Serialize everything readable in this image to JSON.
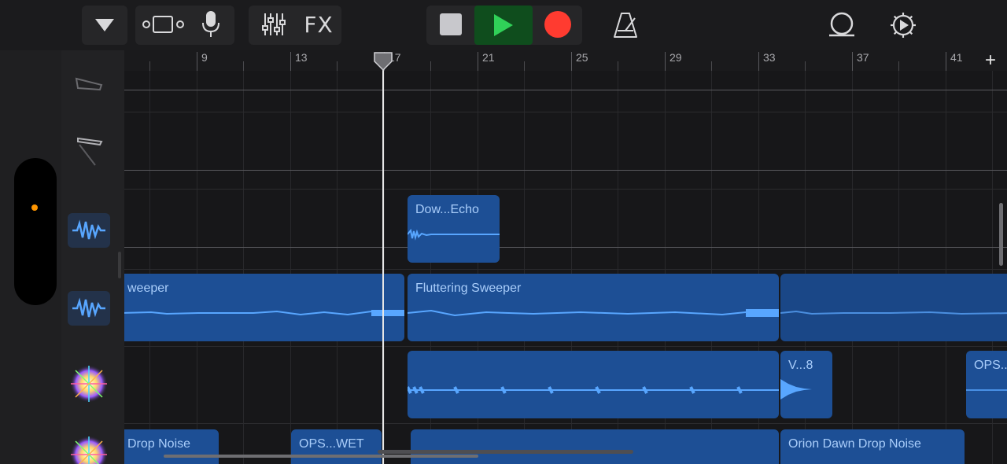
{
  "toolbar": {
    "buttons": [
      {
        "id": "menu",
        "icon": "triangle-down-icon"
      },
      {
        "id": "tracks-view",
        "icon": "tracks-view-icon"
      },
      {
        "id": "mic",
        "icon": "microphone-icon"
      },
      {
        "id": "mixer",
        "icon": "sliders-icon"
      },
      {
        "id": "fx",
        "label": "FX"
      },
      {
        "id": "stop",
        "icon": "stop-icon"
      },
      {
        "id": "play",
        "icon": "play-icon"
      },
      {
        "id": "record",
        "icon": "record-icon"
      },
      {
        "id": "metronome",
        "icon": "metronome-icon"
      },
      {
        "id": "loop",
        "icon": "loop-icon"
      },
      {
        "id": "settings",
        "icon": "gear-icon"
      }
    ],
    "fx_label": "FX",
    "colors": {
      "play_bg": "#0f4d1d",
      "play_icon": "#30d158",
      "record": "#ff3b30"
    }
  },
  "ruler": {
    "bars": [
      "9",
      "13",
      "17",
      "21",
      "25",
      "29",
      "33",
      "37",
      "41"
    ],
    "add_label": "+"
  },
  "tracks": [
    {
      "icon": "synth-icon"
    },
    {
      "icon": "keyboard-icon"
    },
    {
      "icon": "audio-wave-icon"
    },
    {
      "icon": "audio-wave-icon"
    },
    {
      "icon": "sparkle-icon"
    },
    {
      "icon": "sparkle-icon"
    }
  ],
  "regions": {
    "r1": "Dow...Echo",
    "r2a": "weeper",
    "r2b": "Fluttering Sweeper",
    "r3b": "V...8",
    "r3c": "OPS...",
    "r4a": "Drop Noise",
    "r4b": "OPS...WET",
    "r4d": "Orion Dawn Drop Noise"
  },
  "accent": {
    "region": "#1d4f95",
    "region_text": "#a9cdfa",
    "waveform": "#58a6ff"
  }
}
